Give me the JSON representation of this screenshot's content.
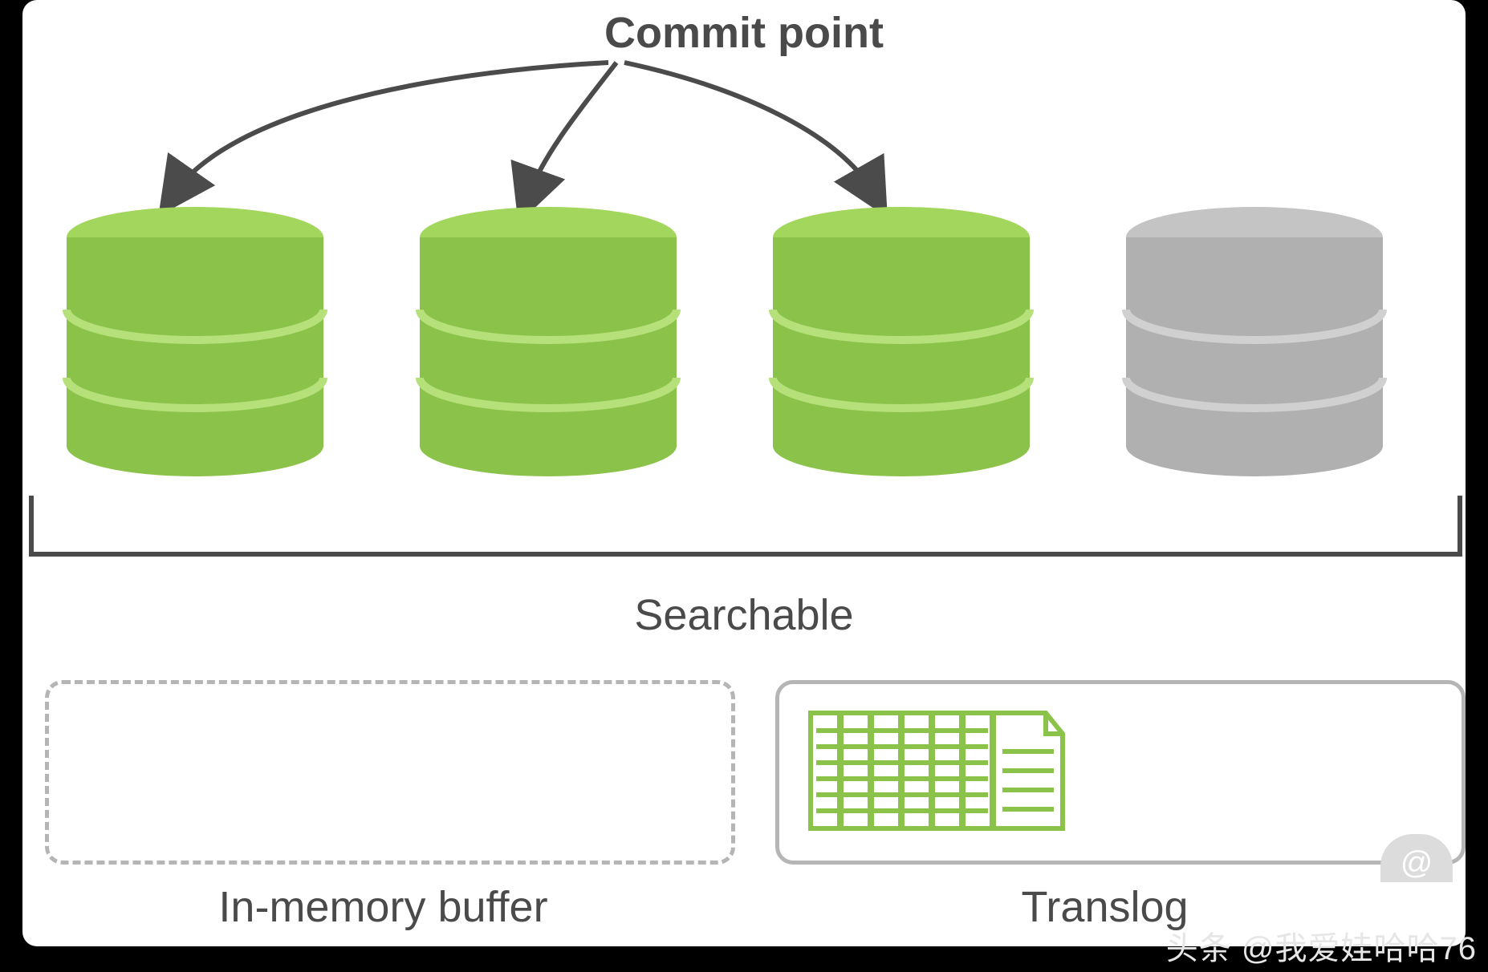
{
  "title": "Commit point",
  "searchable_label": "Searchable",
  "buffer_label": "In-memory buffer",
  "translog_label": "Translog",
  "watermark": "头条 @我爱娃哈哈76",
  "at_glyph": "@",
  "colors": {
    "green_top": "#a3d65c",
    "green_side": "#8bc34a",
    "green_ring": "#b6e07a",
    "gray_top": "#c4c4c4",
    "gray_side": "#b0b0b0",
    "gray_ring": "#d0d0d0",
    "doc_stroke": "#8bc34a"
  },
  "cylinders": [
    {
      "type": "green"
    },
    {
      "type": "green"
    },
    {
      "type": "green"
    },
    {
      "type": "gray"
    }
  ]
}
